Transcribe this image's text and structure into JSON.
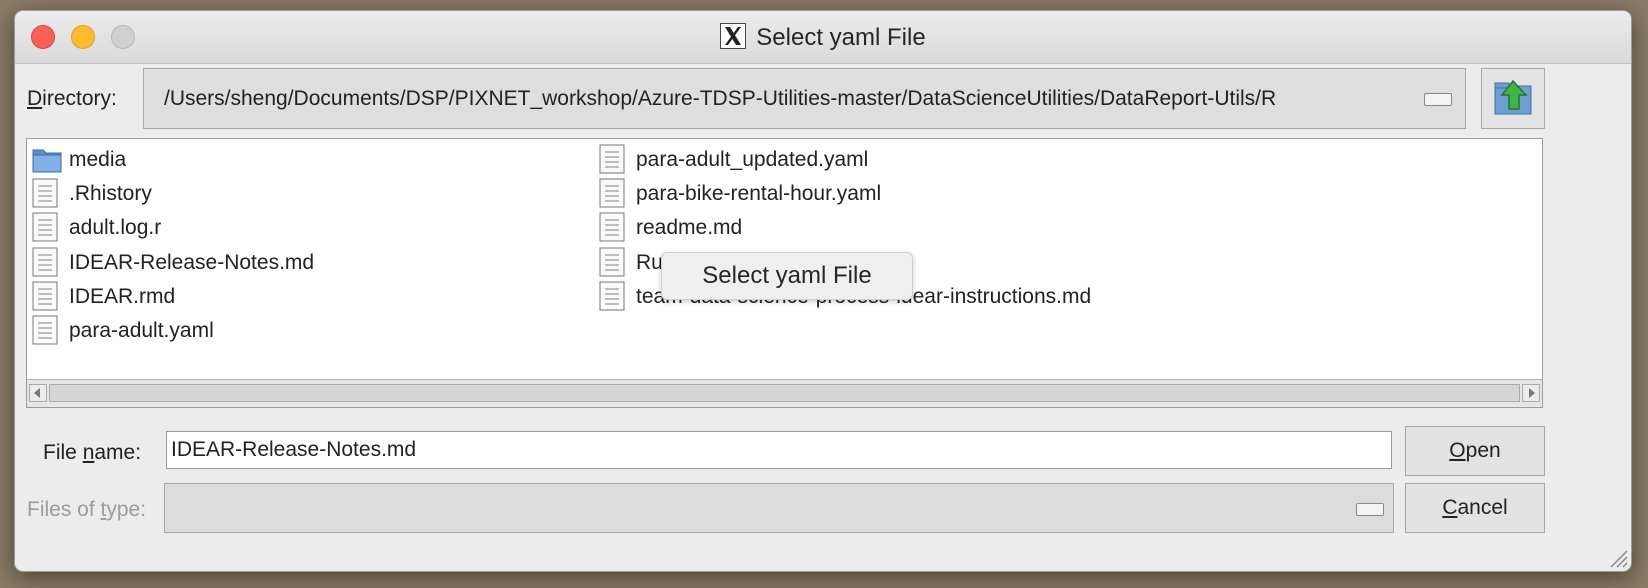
{
  "window": {
    "title": "Select yaml File",
    "tooltip": "Select yaml File"
  },
  "directory": {
    "label_pre": "",
    "label_mnemonic": "D",
    "label_post": "irectory:",
    "path": "/Users/sheng/Documents/DSP/PIXNET_workshop/Azure-TDSP-Utilities-master/DataScienceUtilities/DataReport-Utils/R"
  },
  "files": {
    "col1": [
      {
        "name": "media",
        "icon": "folder-icon"
      },
      {
        "name": ".Rhistory",
        "icon": "file-icon"
      },
      {
        "name": "adult.log.r",
        "icon": "file-icon"
      },
      {
        "name": "IDEAR-Release-Notes.md",
        "icon": "file-icon"
      },
      {
        "name": "IDEAR.rmd",
        "icon": "file-icon"
      },
      {
        "name": "para-adult.yaml",
        "icon": "file-icon"
      }
    ],
    "col2": [
      {
        "name": "para-adult_updated.yaml",
        "icon": "file-icon"
      },
      {
        "name": "para-bike-rental-hour.yaml",
        "icon": "file-icon"
      },
      {
        "name": "readme.md",
        "icon": "file-icon"
      },
      {
        "name": "Ru",
        "icon": "file-icon"
      },
      {
        "name": "team-data-science-process-idear-instructions.md",
        "icon": "file-icon"
      }
    ]
  },
  "filename": {
    "label_pre": "File ",
    "label_mnemonic": "n",
    "label_post": "ame:",
    "value": "IDEAR-Release-Notes.md"
  },
  "filetype": {
    "label_pre": "Files of ",
    "label_mnemonic": "t",
    "label_post": "ype:",
    "value": ""
  },
  "buttons": {
    "open_mnemonic": "O",
    "open_rest": "pen",
    "cancel_mnemonic": "C",
    "cancel_rest": "ancel"
  }
}
